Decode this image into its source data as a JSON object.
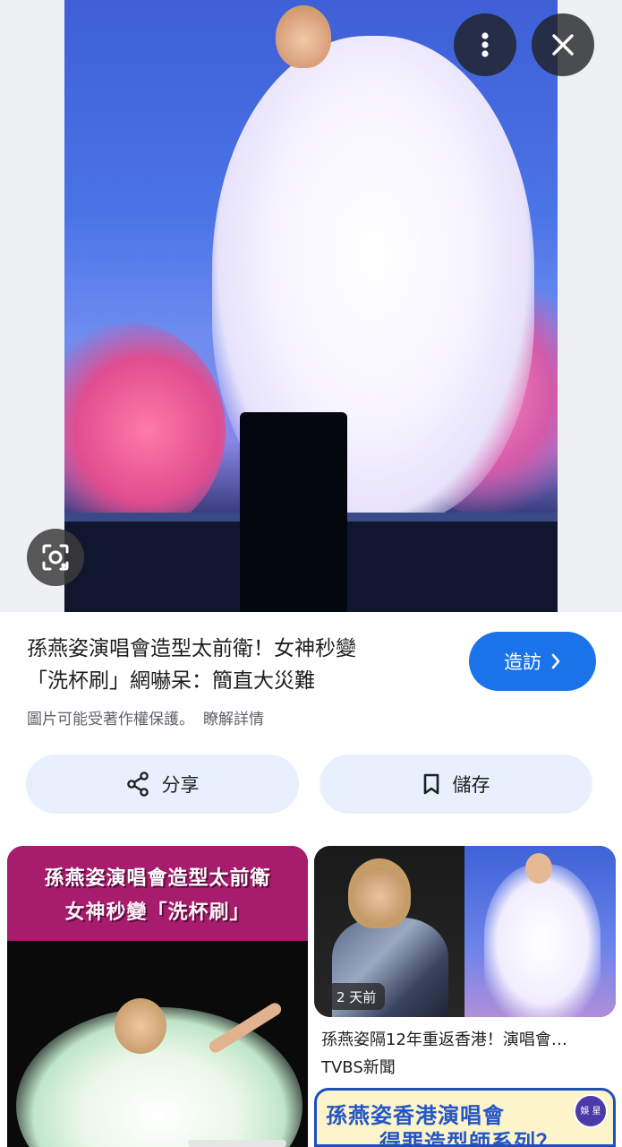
{
  "viewer": {
    "more_options_icon": "more-vert-icon",
    "close_icon": "close-icon",
    "lens_icon": "lens-icon"
  },
  "result": {
    "title_line1": "孫燕姿演唱會造型太前衛！女神秒變",
    "title_line2": "「洗杯刷」網嚇呆：簡直大災難",
    "visit_label": "造訪",
    "copyright_notice": "圖片可能受著作權保護。",
    "learn_more": "瞭解詳情",
    "share_label": "分享",
    "save_label": "儲存"
  },
  "related": [
    {
      "banner_line1": "孫燕姿演唱會造型太前衛",
      "banner_line2": "女神秒變「洗杯刷」"
    },
    {
      "time_badge": "2 天前",
      "title": "孫燕姿隔12年重返香港！演唱會…",
      "source": "TVBS新聞"
    },
    {
      "banner_line1": "孫燕姿香港演唱會",
      "banner_line2": "得罪造型師系列？",
      "logo_text": "娛\n星"
    }
  ],
  "colors": {
    "accent": "#1a73e8",
    "pill_bg": "#e8f0fe"
  }
}
